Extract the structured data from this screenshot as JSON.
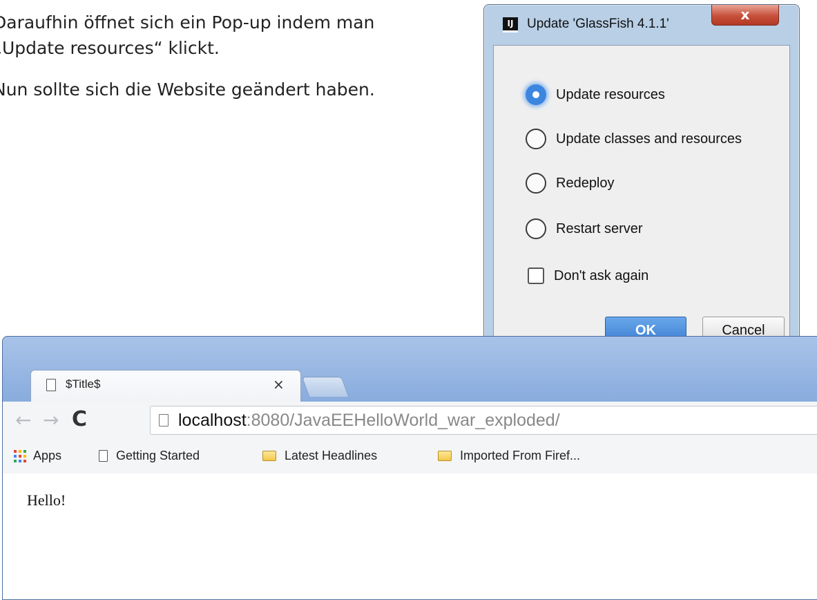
{
  "document": {
    "paragraphs": [
      "Daraufhin öffnet sich ein Pop-up indem man „Update resources“ klickt.",
      "Nun sollte sich die Website geändert haben."
    ]
  },
  "dialog": {
    "icon_label": "IJ",
    "title": "Update 'GlassFish 4.1.1'",
    "close_label": "x",
    "options": [
      {
        "label": "Update resources",
        "selected": true
      },
      {
        "label": "Update classes and resources",
        "selected": false
      },
      {
        "label": "Redeploy",
        "selected": false
      },
      {
        "label": "Restart server",
        "selected": false
      }
    ],
    "checkbox_label": "Don't ask again",
    "checkbox_checked": false,
    "ok_label": "OK",
    "cancel_label": "Cancel"
  },
  "browser": {
    "tab_title": "$Title$",
    "tab_close": "×",
    "nav": {
      "back": "←",
      "forward": "→",
      "reload": "C"
    },
    "url_host": "localhost",
    "url_rest": ":8080/JavaEEHelloWorld_war_exploded/",
    "bookmarks": [
      {
        "label": "Apps",
        "icon": "apps-grid-icon"
      },
      {
        "label": "Getting Started",
        "icon": "page-icon"
      },
      {
        "label": "Latest Headlines",
        "icon": "folder-icon"
      },
      {
        "label": "Imported From Firef...",
        "icon": "folder-icon"
      }
    ],
    "page_text": "Hello!"
  }
}
